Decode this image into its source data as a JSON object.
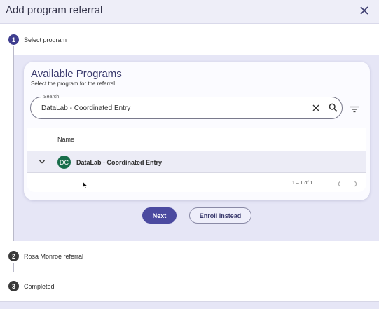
{
  "dialog": {
    "title": "Add program referral"
  },
  "steps": [
    {
      "number": "1",
      "label": "Select program"
    },
    {
      "number": "2",
      "label": "Rosa Monroe referral"
    },
    {
      "number": "3",
      "label": "Completed"
    }
  ],
  "card": {
    "title": "Available Programs",
    "subtitle": "Select the program for the referral"
  },
  "search": {
    "label": "Search",
    "value": "DataLab - Coordinated Entry"
  },
  "table": {
    "column_name": "Name",
    "rows": [
      {
        "initials": "DC",
        "name": "DataLab - Coordinated Entry"
      }
    ],
    "pagination": "1 – 1 of 1"
  },
  "actions": {
    "next": "Next",
    "enroll": "Enroll Instead"
  },
  "colors": {
    "accent": "#4b4aa0",
    "step_active": "#3f3e8f",
    "avatar": "#186d4a"
  }
}
